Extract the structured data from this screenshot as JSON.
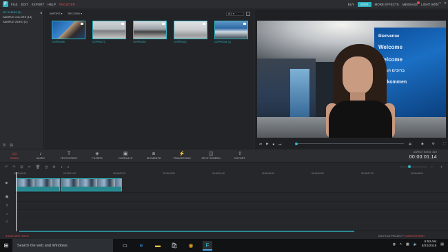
{
  "menu": {
    "logo": "F",
    "items": [
      "FILE",
      "EDIT",
      "EXPORT",
      "HELP"
    ],
    "register": "REGISTER",
    "buy": "BUY",
    "save": "SAVE",
    "more_effects": "MORE EFFECTS",
    "message": "MESSAGE",
    "theme": "LIGHT SKIN"
  },
  "library": {
    "folders": [
      {
        "label": "MY ALBUM (5)",
        "active": true
      },
      {
        "label": "SAMPLE COLORS (13)",
        "active": false
      },
      {
        "label": "SAMPLE VIDEO (3)",
        "active": false
      }
    ],
    "import_label": "IMPORT",
    "record_label": "RECORD",
    "filter_value": "ALL",
    "clips": [
      {
        "label": "GOPR0289"
      },
      {
        "label": "GOPR0273"
      },
      {
        "label": "GOPR0252"
      },
      {
        "label": "GOPR0322"
      },
      {
        "label": "GOPR0336 (1)"
      }
    ]
  },
  "preview": {
    "welcome_words": [
      "Bienvenue",
      "Welcome",
      "Welcome",
      "ברוכים הבאים",
      "Willkommen"
    ]
  },
  "toolbar": {
    "tools": [
      "MEDIA",
      "MUSIC",
      "TEXT/CREDIT",
      "FILTERS",
      "OVERLAYS",
      "ELEMENTS",
      "TRANSITIONS",
      "SPLIT SCREEN",
      "EXPORT"
    ],
    "aspect_ratio": "ASPECT RATIO: 16:9",
    "timecode": "00:00:01.14"
  },
  "timeline": {
    "ruler_ticks": [
      "00:00:00:00",
      "00:00:01:00",
      "00:00:02:00",
      "00:00:03:00",
      "00:00:04:00",
      "00:00:05:00",
      "00:00:06:00",
      "00:00:07:00",
      "00:00:08:00"
    ],
    "add_track": "ADD NEW TRACK",
    "project_name": "UNTITLED PROJECT *",
    "project_status": "UNREGISTERED"
  },
  "taskbar": {
    "search_placeholder": "Search the web and Windows",
    "time": "6:53 AM",
    "date": "8/22/2016"
  }
}
